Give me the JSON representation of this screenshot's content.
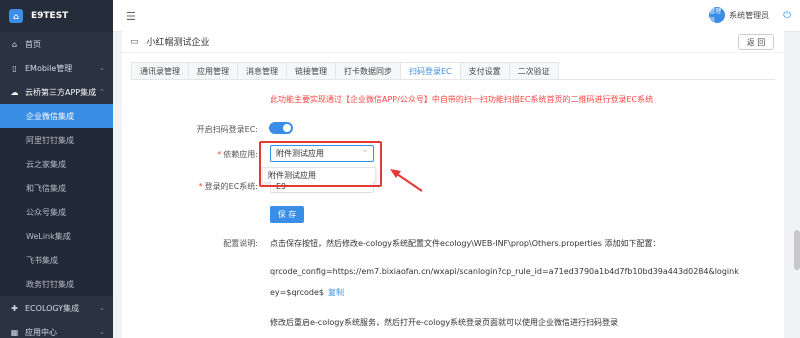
{
  "app": {
    "title": "E9TEST"
  },
  "sidebar": {
    "items": [
      {
        "label": "首页",
        "icon": "home-icon"
      },
      {
        "label": "EMobile管理",
        "icon": "mobile-icon",
        "chevron": "chevron-down-icon"
      },
      {
        "label": "云桥第三方APP集成",
        "icon": "cloud-icon",
        "chevron": "chevron-up-icon"
      }
    ],
    "subitems": [
      {
        "label": "企业微信集成",
        "active": true
      },
      {
        "label": "阿里钉钉集成"
      },
      {
        "label": "云之家集成"
      },
      {
        "label": "和飞信集成"
      },
      {
        "label": "公众号集成"
      },
      {
        "label": "WeLink集成"
      },
      {
        "label": "飞书集成"
      },
      {
        "label": "政务钉钉集成"
      }
    ],
    "bottom_items": [
      {
        "label": "ECOLOGY集成",
        "icon": "puzzle-icon",
        "chevron": "chevron-down-icon"
      },
      {
        "label": "应用中心",
        "icon": "grid-icon",
        "chevron": "chevron-down-icon"
      }
    ]
  },
  "header": {
    "avatar_text": "管理员",
    "user_name": "系统管理员"
  },
  "page": {
    "title": "小红帽测试企业",
    "back_label": "返 回"
  },
  "tabs": [
    {
      "label": "通讯录管理"
    },
    {
      "label": "应用管理"
    },
    {
      "label": "消息管理"
    },
    {
      "label": "链接管理"
    },
    {
      "label": "打卡数据同步"
    },
    {
      "label": "扫码登录EC",
      "active": true
    },
    {
      "label": "支付设置"
    },
    {
      "label": "二次验证"
    }
  ],
  "form": {
    "notice": "此功能主要实现通过【企业微信APP/公众号】中自带的扫一扫功能扫描EC系统首页的二维码进行登录EC系统",
    "enable_label": "开启扫码登录EC:",
    "enabled": true,
    "app_label": "依赖应用:",
    "app_value": "附件测试应用",
    "app_option": "附件测试应用",
    "system_label": "登录的EC系统:",
    "system_value": "E9",
    "save_label": "保 存",
    "config_label": "配置说明:",
    "config_line1": "点击保存按钮，然后修改e-cology系统配置文件ecology\\WEB-INF\\prop\\Others.properties 添加如下配置：",
    "config_line2": "qrcode_config=https://em7.bixiaofan.cn/wxapi/scanlogin?cp_rule_id=a71ed3790a1b4d7fb10bd39a443d0284&logink",
    "config_line3": "ey=$qrcode$",
    "copy_label": "复制",
    "config_line4": "修改后重启e-cology系统服务，然后打开e-cology系统登录页面就可以使用企业微信进行扫码登录"
  },
  "colors": {
    "accent": "#3a8ee6",
    "sidebar": "#2a3342",
    "warning": "#ff4444",
    "annotation": "#e53935"
  }
}
